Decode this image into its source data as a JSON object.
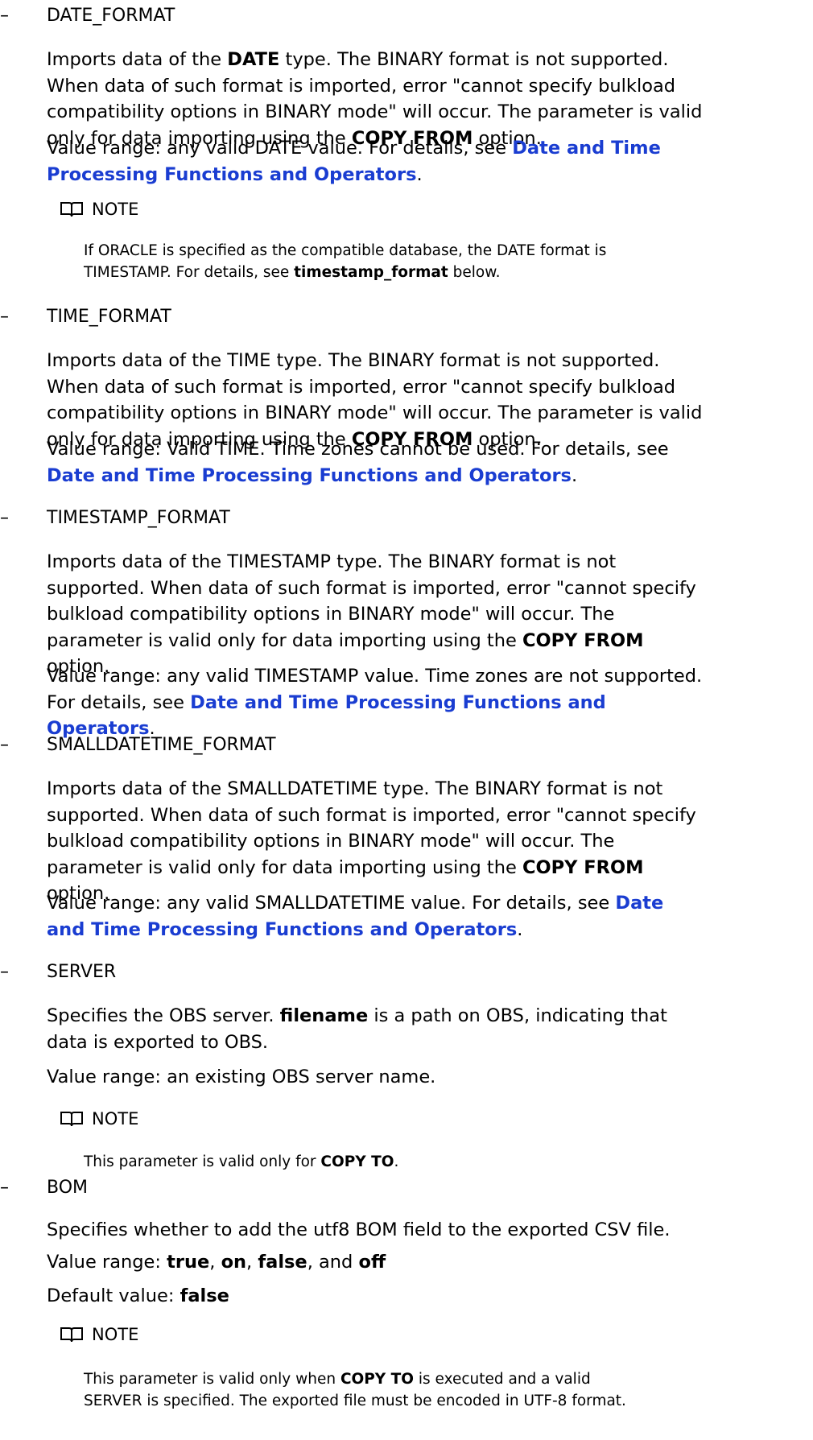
{
  "dash": "–",
  "note_label": "NOTE",
  "link_text": "Date and Time Processing Functions and Operators",
  "date_format": {
    "title": "DATE_FORMAT",
    "desc_1": "Imports data of the ",
    "desc_bold_1": "DATE",
    "desc_2": " type. The BINARY format is not supported. When data of such format is imported, error \"cannot specify bulkload compatibility options in BINARY mode\" will occur. The parameter is valid only for data importing using the ",
    "desc_bold_2": "COPY FROM",
    "desc_3": " option.",
    "range_1": "Value range: any valid DATE value. For details, see ",
    "range_link": "Date and Time Processing Functions and Operators",
    "range_2": ".",
    "note_1": "If ORACLE is specified as the compatible database, the DATE format is TIMESTAMP. For details, see ",
    "note_bold": "timestamp_format",
    "note_2": " below."
  },
  "time_format": {
    "title": "TIME_FORMAT",
    "desc_1": "Imports data of the TIME type. The BINARY format is not supported. When data of such format is imported, error \"cannot specify bulkload compatibility options in BINARY mode\" will occur. The parameter is valid only for data importing using the ",
    "desc_bold": "COPY FROM",
    "desc_2": " option.",
    "range_1": "Value range: Valid TIME. Time zones cannot be used. For details, see ",
    "range_link": "Date and Time Processing Functions and Operators",
    "range_2": "."
  },
  "timestamp_format": {
    "title": "TIMESTAMP_FORMAT",
    "desc_1": "Imports data of the TIMESTAMP type. The BINARY format is not supported. When data of such format is imported, error \"cannot specify bulkload compatibility options in BINARY mode\" will occur. The parameter is valid only for data importing using the ",
    "desc_bold": "COPY FROM",
    "desc_2": " option.",
    "range_1": "Value range: any valid TIMESTAMP value. Time zones are not supported. For details, see ",
    "range_link": "Date and Time Processing Functions and Operators",
    "range_2": "."
  },
  "smalldatetime_format": {
    "title": "SMALLDATETIME_FORMAT",
    "desc_1": "Imports data of the SMALLDATETIME type. The BINARY format is not supported. When data of such format is imported, error \"cannot specify bulkload compatibility options in BINARY mode\" will occur. The parameter is valid only for data importing using the ",
    "desc_bold": "COPY FROM",
    "desc_2": " option.",
    "range_1": "Value range: any valid SMALLDATETIME value. For details, see ",
    "range_link": "Date and Time Processing Functions and Operators",
    "range_2": "."
  },
  "server": {
    "title": "SERVER",
    "desc_1": "Specifies the OBS server. ",
    "desc_bold": "filename",
    "desc_2": " is a path on OBS, indicating that data is exported to OBS.",
    "range": "Value range: an existing OBS server name.",
    "note_1": "This parameter is valid only for ",
    "note_bold": "COPY TO",
    "note_2": "."
  },
  "bom": {
    "title": "BOM",
    "desc": "Specifies whether to add the utf8 BOM field to the exported CSV file.",
    "range_prefix": "Value range: ",
    "range_true": "true",
    "range_sep1": ", ",
    "range_on": "on",
    "range_sep2": ", ",
    "range_false": "false",
    "range_sep3": ", and ",
    "range_off": "off",
    "default_prefix": "Default value: ",
    "default_value": "false",
    "note_1": "This parameter is valid only when ",
    "note_bold": "COPY TO",
    "note_2": " is executed and a valid SERVER is specified. The exported file must be encoded in UTF-8 format."
  }
}
